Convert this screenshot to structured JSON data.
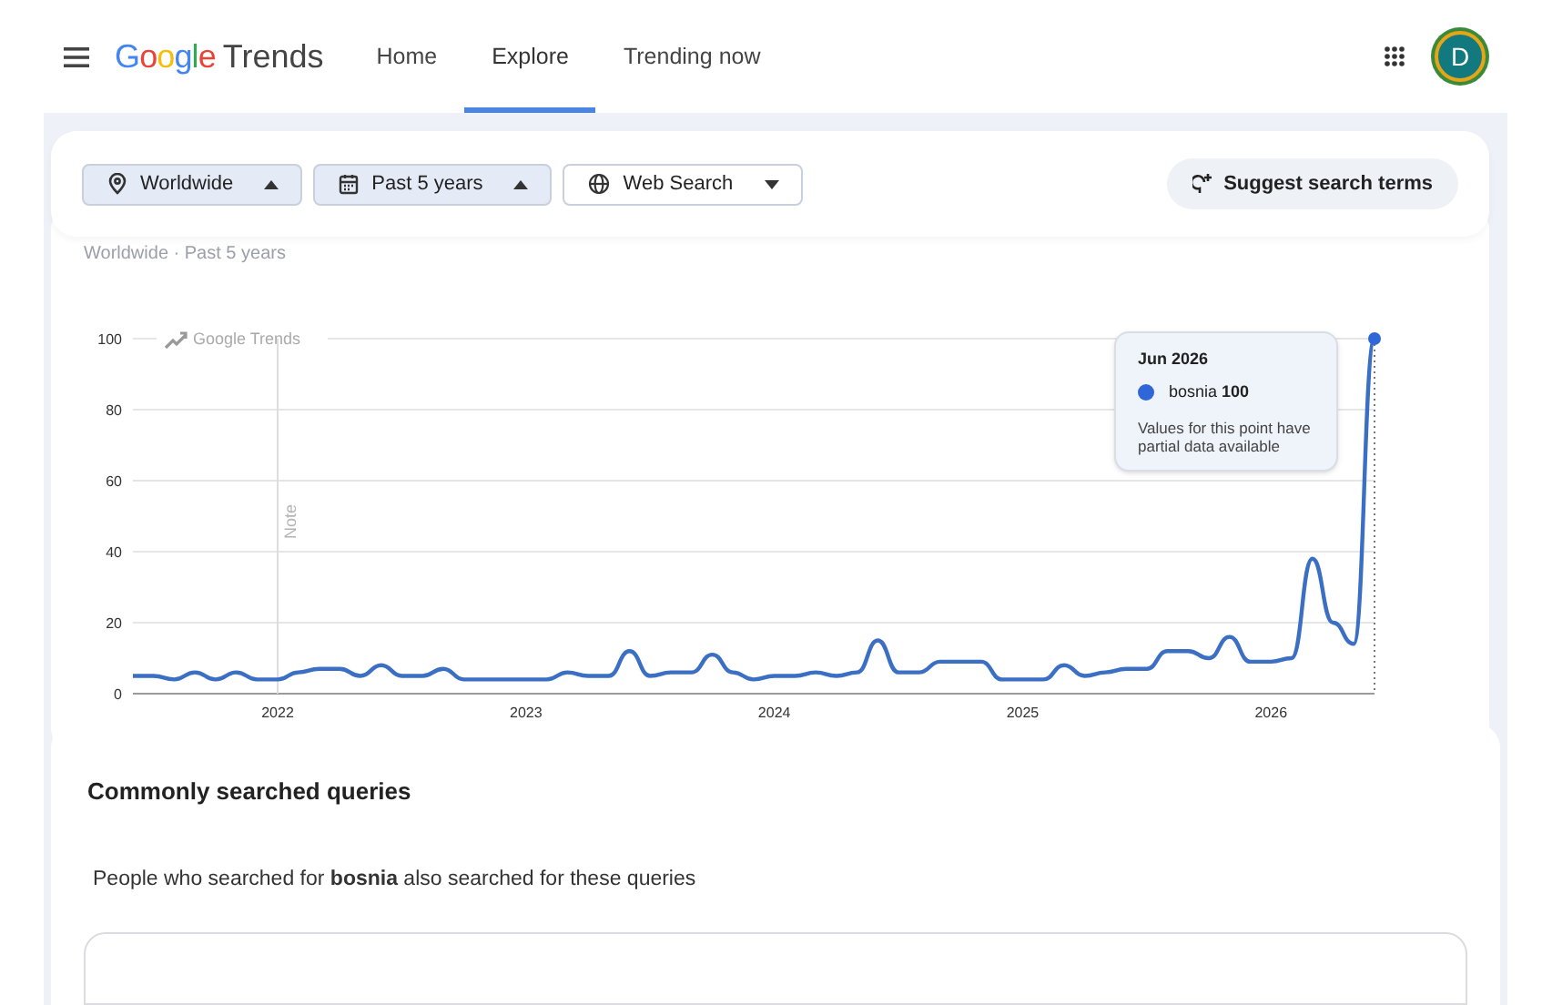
{
  "header": {
    "logo_google": "Google",
    "logo_product": "Trends",
    "tabs": [
      {
        "label": "Home",
        "selected": false
      },
      {
        "label": "Explore",
        "selected": true
      },
      {
        "label": "Trending now",
        "selected": false
      }
    ],
    "avatar_letter": "D"
  },
  "filters": {
    "items": [
      {
        "kind": "dropdown",
        "label": "Worldwide",
        "expanded": true
      },
      {
        "kind": "dropdown",
        "label": "Past 5 years",
        "expanded": true
      },
      {
        "kind": "outlined",
        "label": "Web Search",
        "expanded": false
      }
    ],
    "suggest": "Suggest search terms"
  },
  "breadcrumb": "Worldwide · Past 5 years",
  "chart": {
    "brand_label": "Google Trends",
    "chart_data": {
      "type": "line",
      "grid": true,
      "xlim": [
        2021.417,
        2026.417
      ],
      "ylim": [
        0,
        100
      ],
      "yticks": [
        0,
        20,
        40,
        60,
        80,
        100
      ],
      "xticks": [
        {
          "value": 2022,
          "label": "2022"
        },
        {
          "value": 2023,
          "label": "2023"
        },
        {
          "value": 2024,
          "label": "2024"
        },
        {
          "value": 2025,
          "label": "2025"
        },
        {
          "value": 2026,
          "label": "2026"
        }
      ],
      "x": [
        2021.417,
        2021.5,
        2021.583,
        2021.667,
        2021.75,
        2021.833,
        2021.917,
        2022,
        2022.083,
        2022.167,
        2022.25,
        2022.333,
        2022.417,
        2022.5,
        2022.583,
        2022.667,
        2022.75,
        2022.833,
        2022.917,
        2023,
        2023.083,
        2023.167,
        2023.25,
        2023.333,
        2023.417,
        2023.5,
        2023.583,
        2023.667,
        2023.75,
        2023.833,
        2023.917,
        2024,
        2024.083,
        2024.167,
        2024.25,
        2024.333,
        2024.417,
        2024.5,
        2024.583,
        2024.667,
        2024.75,
        2024.833,
        2024.917,
        2025,
        2025.083,
        2025.167,
        2025.25,
        2025.333,
        2025.417,
        2025.5,
        2025.583,
        2025.667,
        2025.75,
        2025.833,
        2025.917,
        2026,
        2026.083,
        2026.167,
        2026.25,
        2026.333,
        2026.417
      ],
      "series": [
        {
          "name": "bosnia",
          "color": "#3a6fc4",
          "values": [
            5,
            5,
            4,
            6,
            4,
            6,
            4,
            4,
            6,
            7,
            7,
            5,
            8,
            5,
            5,
            7,
            4,
            4,
            4,
            4,
            4,
            6,
            5,
            5,
            12,
            5,
            6,
            6,
            11,
            6,
            4,
            5,
            5,
            6,
            5,
            6,
            15,
            6,
            6,
            9,
            9,
            9,
            4,
            4,
            4,
            8,
            5,
            6,
            7,
            7,
            12,
            12,
            10,
            16,
            9,
            9,
            10,
            38,
            20,
            14,
            100
          ]
        }
      ],
      "ref_lines": [
        {
          "axis": "x",
          "value": 2022,
          "label": "Note"
        }
      ]
    }
  },
  "tooltip": {
    "date": "Jun 2026",
    "value": "100",
    "color": "#2f67d8",
    "message": "Values for this point have partial data available"
  },
  "related": {
    "title": "Commonly searched queries",
    "description": "People who searched for **bosnia** also searched for these queries"
  }
}
